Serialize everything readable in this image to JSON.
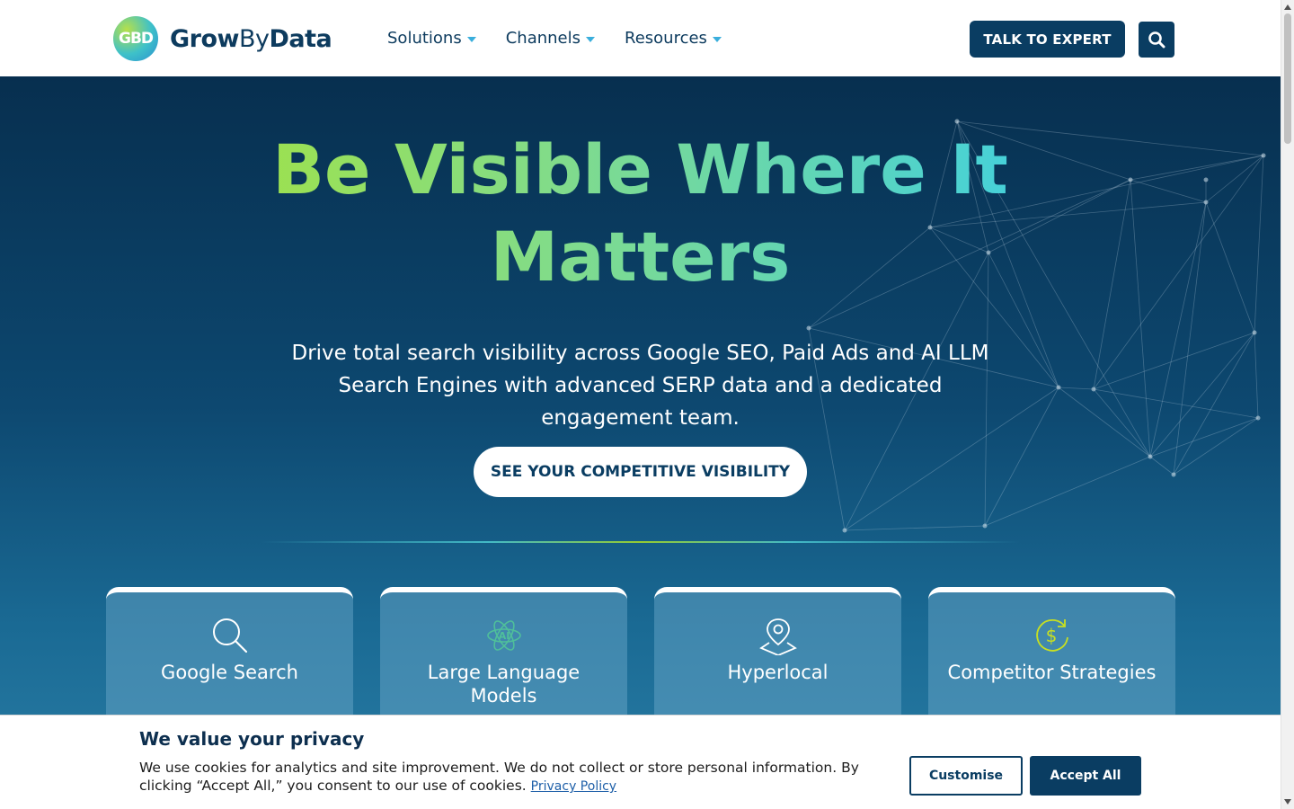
{
  "header": {
    "logo_mark": "GBD",
    "logo_part1": "Grow",
    "logo_part2": "By",
    "logo_part3": "Data",
    "nav": [
      {
        "label": "Solutions"
      },
      {
        "label": "Channels"
      },
      {
        "label": "Resources"
      }
    ],
    "talk_button": "TALK TO EXPERT",
    "search_icon": "search-icon"
  },
  "hero": {
    "title_line1": "Be Visible Where It",
    "title_line2": "Matters",
    "subtitle": "Drive total search visibility across Google SEO, Paid Ads and AI LLM Search Engines with advanced SERP data and a dedicated engagement team.",
    "cta": "SEE YOUR COMPETITIVE VISIBILITY"
  },
  "cards": [
    {
      "title": "Google Search",
      "icon": "magnifier-icon"
    },
    {
      "title": "Large Language Models",
      "icon": "ai-atom-icon"
    },
    {
      "title": "Hyperlocal",
      "icon": "map-pin-icon"
    },
    {
      "title": "Competitor Strategies",
      "icon": "dollar-refresh-icon"
    }
  ],
  "cookie": {
    "title": "We value your privacy",
    "text": "We use cookies for analytics and site improvement. We do not collect or store personal information. By clicking “Accept All,” you consent to our use of cookies.",
    "link": "Privacy Policy",
    "customise": "Customise",
    "accept": "Accept All"
  },
  "colors": {
    "brand_navy": "#0a3d62",
    "accent_green": "#b5e61d",
    "accent_cyan": "#3ccfe6",
    "caret": "#3aaedc"
  }
}
